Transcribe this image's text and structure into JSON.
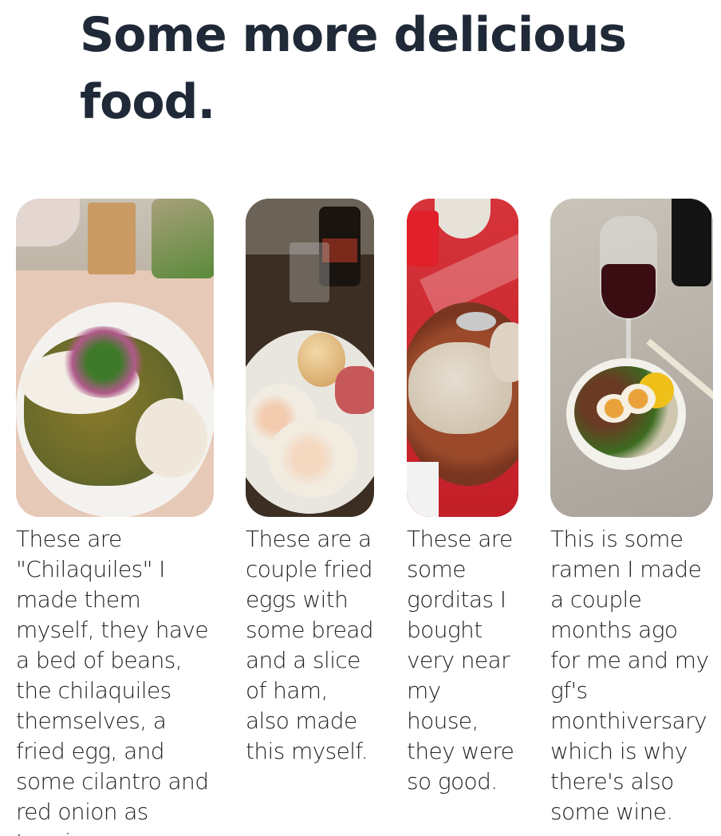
{
  "heading": "Some more delicious food.",
  "cards": [
    {
      "image_alt": "chilaquiles plate photo",
      "caption": "These are \"Chilaquiles\" I made them myself, they have a bed of beans, the chilaquiles themselves, a fried egg, and some cilantro and red onion as topping."
    },
    {
      "image_alt": "fried eggs with bread and ham photo",
      "caption": "These are a couple fried eggs with some bread and a slice of ham, also made this myself."
    },
    {
      "image_alt": "gorditas on a plate photo",
      "caption": "These are some gorditas I bought very near my house, they were so good."
    },
    {
      "image_alt": "ramen with wine photo",
      "caption": "This is some ramen I made a couple months ago for me and my gf's monthiversary which is why there's also some wine."
    }
  ]
}
